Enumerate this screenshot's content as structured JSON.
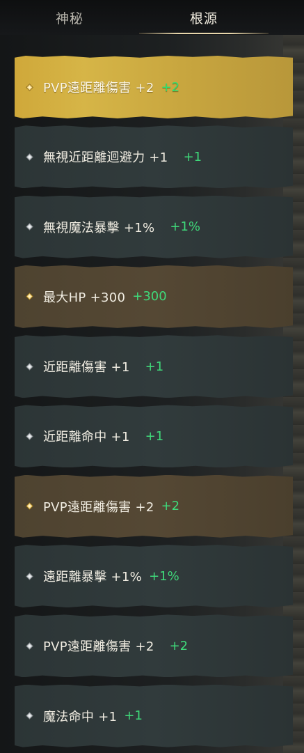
{
  "tabs": [
    {
      "label": "神秘"
    },
    {
      "label": "根源"
    }
  ],
  "colors": {
    "bonus_green": "#3fd97a",
    "gold_row": "#cfa83a",
    "brown_row": "#4e4330",
    "slate_row": "#2c3536"
  },
  "stats": [
    {
      "label": "PVP遠距離傷害 +2",
      "bonus": "+2",
      "style": "gold",
      "icon": "diamond-gold-icon"
    },
    {
      "label": "無視近距離迴避力 +1",
      "bonus": "+1",
      "style": "slate",
      "icon": "diamond-silver-icon"
    },
    {
      "label": "無視魔法暴擊 +1%",
      "bonus": "+1%",
      "style": "slate",
      "icon": "diamond-silver-icon"
    },
    {
      "label": "最大HP +300",
      "bonus": "+300",
      "style": "brown",
      "icon": "diamond-gold-icon"
    },
    {
      "label": "近距離傷害 +1",
      "bonus": "+1",
      "style": "slate",
      "icon": "diamond-silver-icon"
    },
    {
      "label": "近距離命中 +1",
      "bonus": "+1",
      "style": "slate",
      "icon": "diamond-silver-icon"
    },
    {
      "label": "PVP遠距離傷害 +2",
      "bonus": "+2",
      "style": "brown",
      "icon": "diamond-gold-icon"
    },
    {
      "label": "遠距離暴擊 +1%",
      "bonus": "+1%",
      "style": "slate",
      "icon": "diamond-silver-icon"
    },
    {
      "label": "PVP遠距離傷害 +2",
      "bonus": "+2",
      "style": "slate",
      "icon": "diamond-silver-icon"
    },
    {
      "label": "魔法命中 +1",
      "bonus": "+1",
      "style": "slate",
      "icon": "diamond-silver-icon"
    }
  ]
}
